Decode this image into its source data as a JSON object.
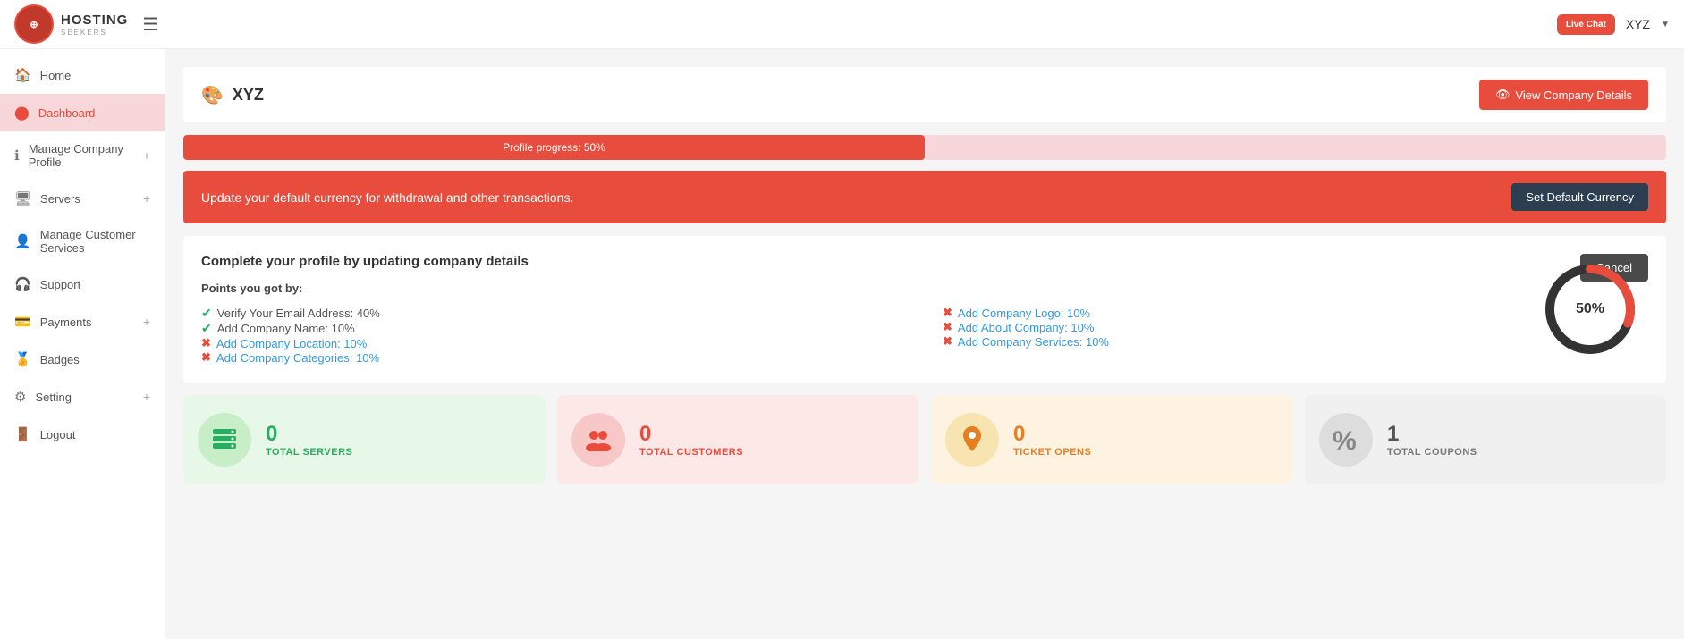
{
  "topbar": {
    "logo_text": "HOSTING",
    "logo_sub": "SEEKERS",
    "live_chat_label": "Live Chat",
    "user_name": "XYZ",
    "dropdown_symbol": "▼"
  },
  "sidebar": {
    "items": [
      {
        "id": "home",
        "icon": "🏠",
        "label": "Home",
        "has_plus": false
      },
      {
        "id": "dashboard",
        "icon": "📊",
        "label": "Dashboard",
        "has_plus": false,
        "active": true
      },
      {
        "id": "manage-company",
        "icon": "ℹ",
        "label": "Manage Company Profile",
        "has_plus": true
      },
      {
        "id": "servers",
        "icon": "🖥",
        "label": "Servers",
        "has_plus": true
      },
      {
        "id": "manage-customer",
        "icon": "👤",
        "label": "Manage Customer Services",
        "has_plus": false
      },
      {
        "id": "support",
        "icon": "🎧",
        "label": "Support",
        "has_plus": false
      },
      {
        "id": "payments",
        "icon": "💳",
        "label": "Payments",
        "has_plus": true
      },
      {
        "id": "badges",
        "icon": "⚙",
        "label": "Badges",
        "has_plus": false
      },
      {
        "id": "setting",
        "icon": "⚙",
        "label": "Setting",
        "has_plus": true
      },
      {
        "id": "logout",
        "icon": "🚪",
        "label": "Logout",
        "has_plus": false
      }
    ]
  },
  "content": {
    "company_name": "XYZ",
    "view_company_btn": "View Company Details",
    "view_company_icon": "👁",
    "progress_label": "Profile progress: 50%",
    "progress_value": 50,
    "alert_message": "Update your default currency for withdrawal and other transactions.",
    "set_currency_btn": "Set Default Currency",
    "profile_card": {
      "title": "Complete your profile by updating company details",
      "cancel_btn": "Cancel",
      "points_label": "Points you got by:",
      "completed_items": [
        "Verify Your Email Address: 40%",
        "Add Company Name: 10%"
      ],
      "pending_items_left": [
        "Add Company Location: 10%",
        "Add Company Categories: 10%"
      ],
      "pending_items_right": [
        "Add Company Logo: 10%",
        "Add About Company: 10%",
        "Add Company Services: 10%"
      ],
      "donut_percent": "50%"
    },
    "stats": [
      {
        "id": "servers",
        "number": "0",
        "label": "TOTAL SERVERS",
        "theme": "green",
        "icon": "servers"
      },
      {
        "id": "customers",
        "number": "0",
        "label": "TOTAL CUSTOMERS",
        "theme": "pink",
        "icon": "customers"
      },
      {
        "id": "tickets",
        "number": "0",
        "label": "TICKET OPENS",
        "theme": "yellow",
        "icon": "location"
      },
      {
        "id": "coupons",
        "number": "1",
        "label": "TOTAL COUPONS",
        "theme": "gray",
        "icon": "percent"
      }
    ]
  }
}
